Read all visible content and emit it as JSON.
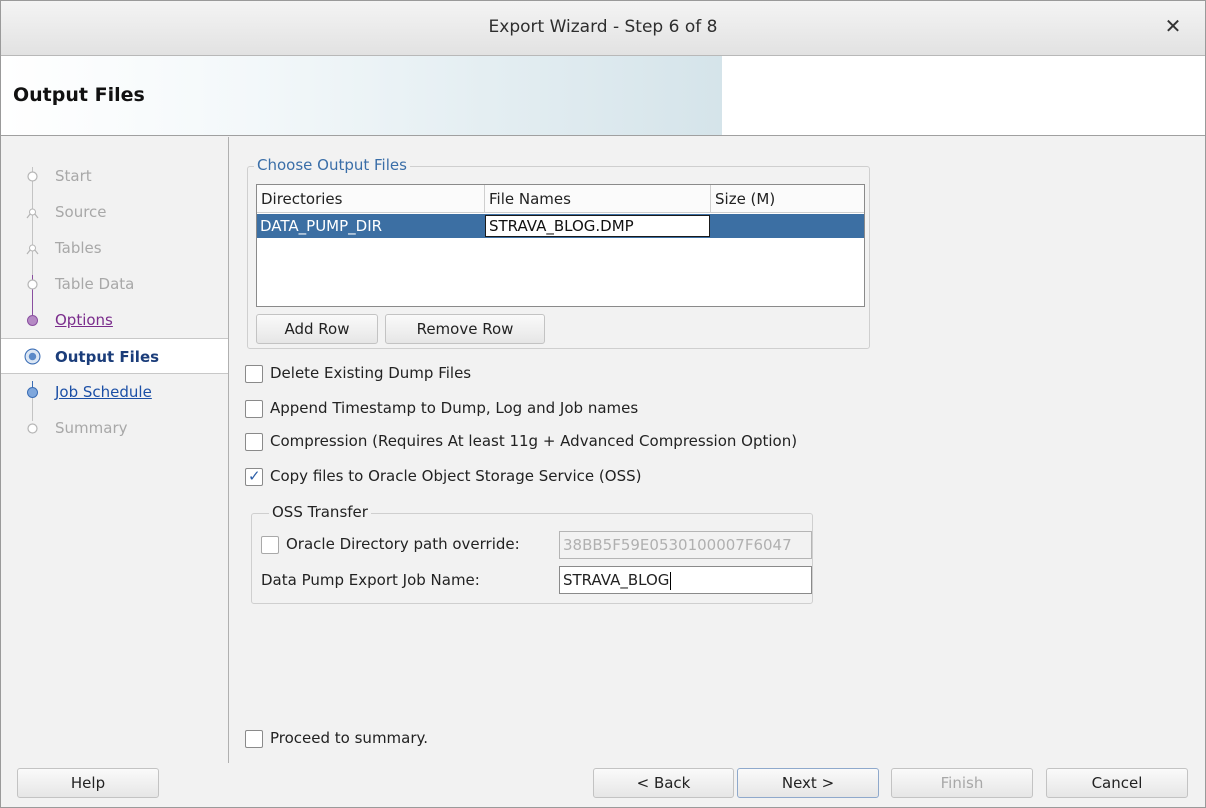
{
  "window": {
    "title": "Export Wizard - Step 6 of 8",
    "close_glyph": "✕"
  },
  "banner": {
    "heading": "Output Files"
  },
  "nav": {
    "items": [
      {
        "label": "Start",
        "state": "disabled"
      },
      {
        "label": "Source",
        "state": "disabled"
      },
      {
        "label": "Tables",
        "state": "disabled"
      },
      {
        "label": "Table Data",
        "state": "disabled"
      },
      {
        "label": "Options",
        "state": "visited"
      },
      {
        "label": "Output Files",
        "state": "current"
      },
      {
        "label": "Job Schedule",
        "state": "link"
      },
      {
        "label": "Summary",
        "state": "disabled"
      }
    ]
  },
  "output_files": {
    "legend": "Choose Output Files",
    "columns": [
      "Directories",
      "File Names",
      "Size (M)"
    ],
    "rows": [
      {
        "directory": "DATA_PUMP_DIR",
        "file_name": "STRAVA_BLOG.DMP",
        "size": ""
      }
    ],
    "add_row_label": "Add Row",
    "remove_row_label": "Remove Row"
  },
  "options": {
    "delete_existing": {
      "label": "Delete Existing Dump Files",
      "checked": false
    },
    "append_timestamp": {
      "label": "Append Timestamp to Dump, Log and Job names",
      "checked": false
    },
    "compression": {
      "label": "Compression (Requires At least 11g + Advanced Compression Option)",
      "checked": false
    },
    "copy_to_oss": {
      "label": "Copy files to Oracle Object Storage Service (OSS)",
      "checked": true
    }
  },
  "oss_transfer": {
    "legend": "OSS Transfer",
    "dir_override_label": "Oracle Directory path override:",
    "dir_override_checked": false,
    "dir_override_value": "38BB5F59E0530100007F6047",
    "job_name_label": "Data Pump Export Job Name:",
    "job_name_value": "STRAVA_BLOG"
  },
  "proceed_summary": {
    "label": "Proceed to summary.",
    "checked": false
  },
  "footer": {
    "help_label": "Help",
    "back_label": "< Back",
    "next_label": "Next >",
    "finish_label": "Finish",
    "cancel_label": "Cancel"
  },
  "colors": {
    "selection_row": "#3c6fa3",
    "link": "#1b4fa6",
    "visited_link": "#7a2c8c",
    "current_step": "#1b3d7a",
    "banner_gradient_end": "#d5e4ea"
  }
}
